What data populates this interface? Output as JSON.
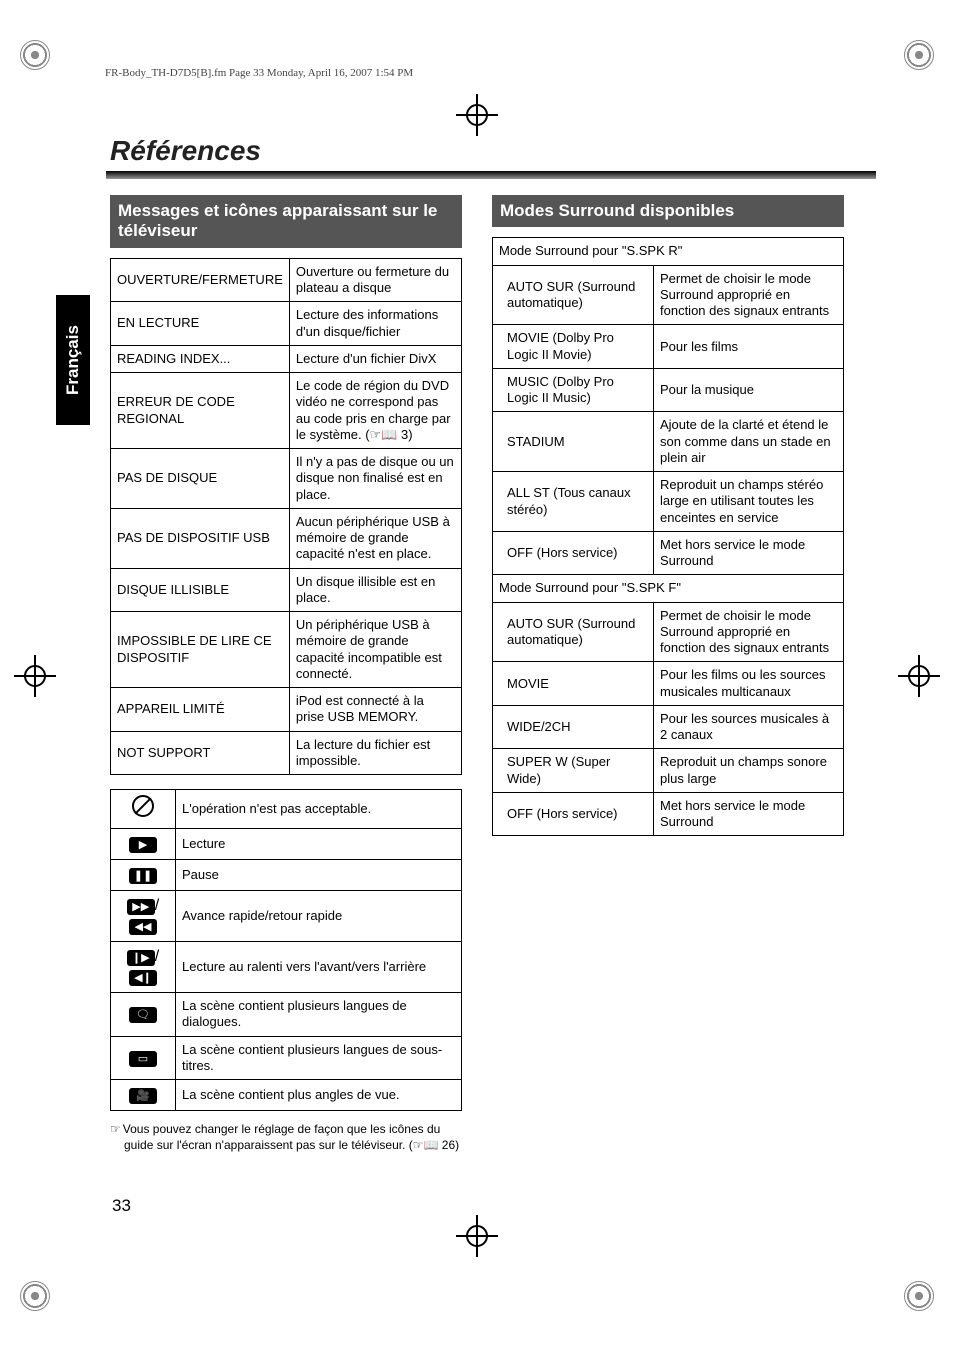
{
  "header_line": "FR-Body_TH-D7D5[B].fm  Page 33  Monday, April 16, 2007  1:54 PM",
  "title": "Références",
  "side_tab": "Français",
  "page_number": "33",
  "section_left": "Messages et icônes apparaissant sur le téléviseur",
  "section_right": "Modes Surround disponibles",
  "messages": [
    {
      "key": "OUVERTURE/FERMETURE",
      "desc": "Ouverture ou fermeture du plateau a disque"
    },
    {
      "key": "EN LECTURE",
      "desc": "Lecture des informations d'un disque/fichier"
    },
    {
      "key": "READING INDEX...",
      "desc": "Lecture d'un fichier DivX"
    },
    {
      "key": "ERREUR DE CODE REGIONAL",
      "desc": "Le code de région du DVD vidéo ne correspond pas au code pris en charge par le système. (☞📖 3)"
    },
    {
      "key": "PAS DE DISQUE",
      "desc": "Il n'y a pas de disque ou un disque non finalisé est en place."
    },
    {
      "key": "PAS DE DISPOSITIF USB",
      "desc": "Aucun périphérique USB à mémoire de grande capacité n'est en place."
    },
    {
      "key": "DISQUE ILLISIBLE",
      "desc": "Un disque illisible est en place."
    },
    {
      "key": "IMPOSSIBLE DE LIRE CE DISPOSITIF",
      "desc": "Un périphérique USB à mémoire de grande capacité incompatible est connecté."
    },
    {
      "key": "APPAREIL LIMITÉ",
      "desc": "iPod est connecté à la prise USB MEMORY."
    },
    {
      "key": "NOT SUPPORT",
      "desc": "La lecture du fichier est impossible."
    }
  ],
  "icons": [
    {
      "sym": "slash",
      "desc": "L'opération n'est pas acceptable."
    },
    {
      "sym": "play",
      "desc": "Lecture"
    },
    {
      "sym": "pause",
      "desc": "Pause"
    },
    {
      "sym": "ffrw",
      "desc": "Avance rapide/retour rapide"
    },
    {
      "sym": "slow",
      "desc": "Lecture au ralenti vers l'avant/vers l'arrière"
    },
    {
      "sym": "audio",
      "desc": "La scène contient plusieurs langues de dialogues."
    },
    {
      "sym": "subtitle",
      "desc": "La scène contient plusieurs langues de sous-titres."
    },
    {
      "sym": "angle",
      "desc": "La scène contient plus angles de vue."
    }
  ],
  "footnote": "Vous pouvez changer le réglage de façon que les icônes du guide sur l'écran n'apparaissent pas sur le téléviseur. (☞📖 26)",
  "surround_group1": "Mode Surround pour \"S.SPK R\"",
  "surround_r": [
    {
      "key": "AUTO SUR (Surround automatique)",
      "desc": "Permet de choisir le mode Surround approprié en fonction des signaux entrants"
    },
    {
      "key": "MOVIE (Dolby Pro Logic II Movie)",
      "desc": "Pour les films"
    },
    {
      "key": "MUSIC (Dolby Pro Logic II Music)",
      "desc": "Pour la musique"
    },
    {
      "key": "STADIUM",
      "desc": "Ajoute de la clarté et étend le son comme dans un stade en plein air"
    },
    {
      "key": "ALL ST (Tous canaux stéréo)",
      "desc": "Reproduit un champs stéréo large en utilisant toutes les enceintes en service"
    },
    {
      "key": "OFF (Hors service)",
      "desc": "Met hors service le mode Surround"
    }
  ],
  "surround_group2": "Mode Surround pour \"S.SPK F\"",
  "surround_f": [
    {
      "key": "AUTO SUR (Surround automatique)",
      "desc": "Permet de choisir le mode Surround approprié en fonction des signaux entrants"
    },
    {
      "key": "MOVIE",
      "desc": "Pour les films ou les sources musicales multicanaux"
    },
    {
      "key": "WIDE/2CH",
      "desc": "Pour les sources musicales à 2 canaux"
    },
    {
      "key": "SUPER W (Super Wide)",
      "desc": "Reproduit un champs sonore plus large"
    },
    {
      "key": "OFF (Hors service)",
      "desc": "Met hors service le mode Surround"
    }
  ]
}
